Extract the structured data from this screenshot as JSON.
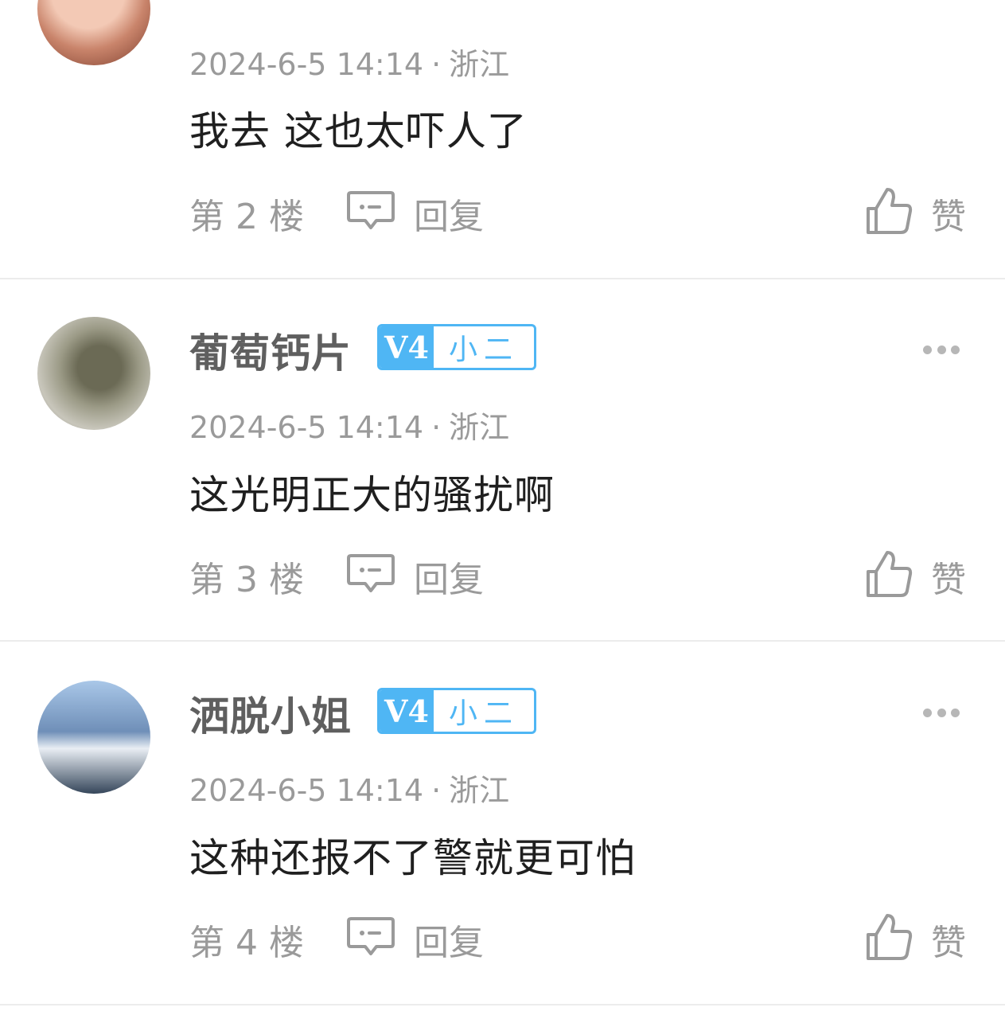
{
  "comments": [
    {
      "username": "",
      "level": "",
      "title": "",
      "date": "2024-6-5 14:14",
      "location": "浙江",
      "text": "我去 这也太吓人了",
      "floor": "第 2 楼",
      "reply_label": "回复",
      "like_label": "赞",
      "avatar_icon": "user-avatar"
    },
    {
      "username": "葡萄钙片",
      "level": "V4",
      "title": "小二",
      "date": "2024-6-5 14:14",
      "location": "浙江",
      "text": "这光明正大的骚扰啊",
      "floor": "第 3 楼",
      "reply_label": "回复",
      "like_label": "赞",
      "avatar_icon": "user-avatar"
    },
    {
      "username": "洒脱小姐",
      "level": "V4",
      "title": "小二",
      "date": "2024-6-5 14:14",
      "location": "浙江",
      "text": "这种还报不了警就更可怕",
      "floor": "第 4 楼",
      "reply_label": "回复",
      "like_label": "赞",
      "avatar_icon": "user-avatar"
    }
  ],
  "separator": "·",
  "colors": {
    "badge_blue": "#4fb6f4",
    "meta_gray": "#9a9a9a",
    "username_gray": "#5f5f5f"
  }
}
